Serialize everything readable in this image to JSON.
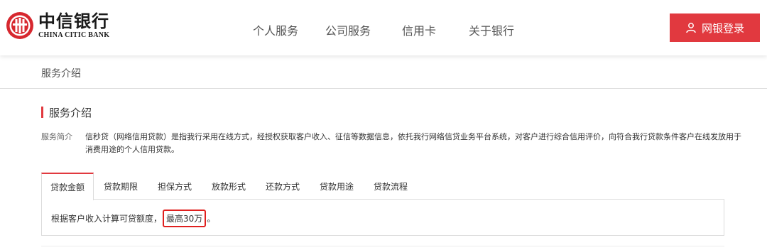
{
  "header": {
    "logo_cn": "中信银行",
    "logo_en": "CHINA CITIC BANK",
    "nav": [
      "个人服务",
      "公司服务",
      "信用卡",
      "关于银行"
    ],
    "login_label": "网银登录",
    "accent_color": "#e1393f"
  },
  "breadcrumb": "服务介绍",
  "section": {
    "title": "服务介绍",
    "intro_label": "服务简介",
    "intro_text": "信秒贷（网络信用贷款）是指我行采用在线方式，经授权获取客户收入、征信等数据信息，依托我行网络信贷业务平台系统，对客户进行综合信用评价，向符合我行贷款条件客户在线发放用于消费用途的个人信用贷款。"
  },
  "tabs": [
    "贷款金额",
    "贷款期限",
    "担保方式",
    "放款形式",
    "还款方式",
    "贷款用途",
    "贷款流程"
  ],
  "panel": {
    "text_before": "根据客户收入计算可贷额度，",
    "highlight": "最高30万",
    "text_after": "。"
  }
}
